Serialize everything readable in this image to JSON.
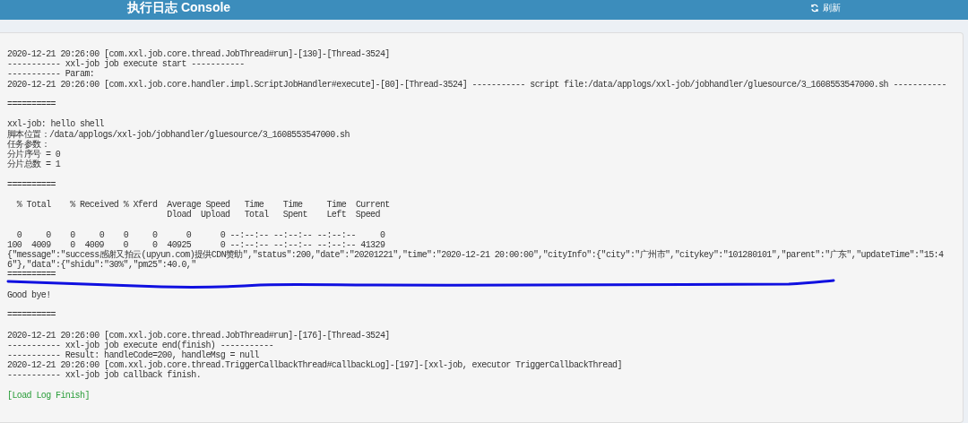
{
  "header": {
    "title": "执行日志 Console",
    "refresh": "刷新"
  },
  "log": [
    {
      "kind": "line",
      "text": "2020-12-21 20:26:00 [com.xxl.job.core.thread.JobThread#run]-[130]-[Thread-3524]"
    },
    {
      "kind": "line",
      "text": "----------- xxl-job job execute start -----------"
    },
    {
      "kind": "line",
      "text": "----------- Param:"
    },
    {
      "kind": "line",
      "text": "2020-12-21 20:26:00 [com.xxl.job.core.handler.impl.ScriptJobHandler#execute]-[80]-[Thread-3524] ----------- script file:/data/applogs/xxl-job/jobhandler/gluesource/3_1608553547000.sh -----------"
    },
    {
      "kind": "blank"
    },
    {
      "kind": "line",
      "text": "=========="
    },
    {
      "kind": "blank"
    },
    {
      "kind": "line",
      "text": "xxl-job: hello shell"
    },
    {
      "kind": "line",
      "text": "脚本位置：/data/applogs/xxl-job/jobhandler/gluesource/3_1608553547000.sh"
    },
    {
      "kind": "line",
      "text": "任务参数："
    },
    {
      "kind": "line",
      "text": "分片序号 = 0"
    },
    {
      "kind": "line",
      "text": "分片总数 = 1"
    },
    {
      "kind": "blank"
    },
    {
      "kind": "line",
      "text": "=========="
    },
    {
      "kind": "blank"
    },
    {
      "kind": "line",
      "text": "  % Total    % Received % Xferd  Average Speed   Time    Time     Time  Current"
    },
    {
      "kind": "line",
      "text": "                                 Dload  Upload   Total   Spent    Left  Speed"
    },
    {
      "kind": "blank"
    },
    {
      "kind": "line",
      "text": "  0     0    0     0    0     0      0      0 --:--:-- --:--:-- --:--:--     0"
    },
    {
      "kind": "line",
      "text": "100  4009    0  4009    0     0  40925      0 --:--:-- --:--:-- --:--:-- 41329"
    },
    {
      "kind": "line",
      "text": "{\"message\":\"success感谢又拍云(upyun.com)提供CDN赞助\",\"status\":200,\"date\":\"20201221\",\"time\":\"2020-12-21 20:00:00\",\"cityInfo\":{\"city\":\"广州市\",\"citykey\":\"101280101\",\"parent\":\"广东\",\"updateTime\":\"15:46\"},\"data\":{\"shidu\":\"30%\",\"pm25\":40.0,\""
    },
    {
      "kind": "line",
      "text": "=========="
    },
    {
      "kind": "blank"
    },
    {
      "kind": "line",
      "text": "Good bye!"
    },
    {
      "kind": "blank"
    },
    {
      "kind": "line",
      "text": "=========="
    },
    {
      "kind": "blank"
    },
    {
      "kind": "line",
      "text": "2020-12-21 20:26:00 [com.xxl.job.core.thread.JobThread#run]-[176]-[Thread-3524]"
    },
    {
      "kind": "line",
      "text": "----------- xxl-job job execute end(finish) -----------"
    },
    {
      "kind": "line",
      "text": "----------- Result: handleCode=200, handleMsg = null"
    },
    {
      "kind": "line",
      "text": "2020-12-21 20:26:00 [com.xxl.job.core.thread.TriggerCallbackThread#callbackLog]-[197]-[xxl-job, executor TriggerCallbackThread]"
    },
    {
      "kind": "line",
      "text": "----------- xxl-job job callback finish."
    },
    {
      "kind": "blank"
    },
    {
      "kind": "finish",
      "text": "[Load Log Finish]"
    }
  ]
}
